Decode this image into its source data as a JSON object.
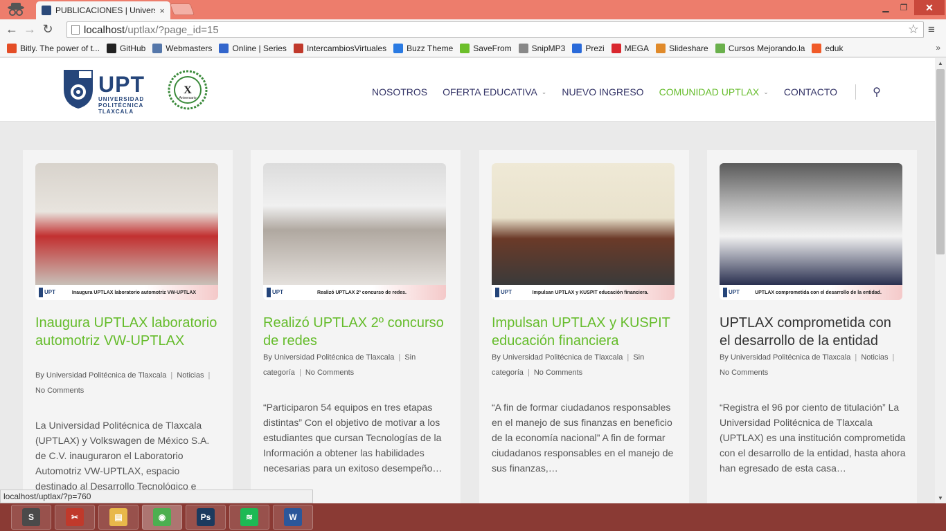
{
  "browser": {
    "tab_title": "PUBLICACIONES | Univers",
    "tab_close": "×",
    "url_host": "localhost",
    "url_path": "/uptlax/?page_id=15",
    "window_controls": {
      "minimize": "▁",
      "maximize": "❐",
      "close": "✕"
    },
    "nav_icons": {
      "back": "←",
      "forward": "→",
      "reload": "↻",
      "star": "☆",
      "menu": "≡"
    },
    "bookmarks": [
      {
        "label": "Bitly. The power of t...",
        "icon": "bitly-icon",
        "color": "#e44d26"
      },
      {
        "label": "GitHub",
        "icon": "github-icon",
        "color": "#222222"
      },
      {
        "label": "Webmasters",
        "icon": "webmasters-icon",
        "color": "#5577aa"
      },
      {
        "label": "Online | Series",
        "icon": "series-icon",
        "color": "#3366cc"
      },
      {
        "label": "IntercambiosVirtuales",
        "icon": "iv-icon",
        "color": "#c0392b"
      },
      {
        "label": "Buzz Theme",
        "icon": "buzz-icon",
        "color": "#2a7ae2"
      },
      {
        "label": "SaveFrom",
        "icon": "savefrom-icon",
        "color": "#6cbf2a"
      },
      {
        "label": "SnipMP3",
        "icon": "snipmp3-icon",
        "color": "#888888"
      },
      {
        "label": "Prezi",
        "icon": "prezi-icon",
        "color": "#2a6ad9"
      },
      {
        "label": "MEGA",
        "icon": "mega-icon",
        "color": "#d9272e"
      },
      {
        "label": "Slideshare",
        "icon": "slideshare-icon",
        "color": "#e08a2a"
      },
      {
        "label": "Cursos Mejorando.la",
        "icon": "mejorando-icon",
        "color": "#6ab04c"
      },
      {
        "label": "eduk",
        "icon": "eduk-icon",
        "color": "#f05a28"
      }
    ],
    "bookmarks_more": "»"
  },
  "site": {
    "logo_text": "UPT",
    "logo_sub": "UNIVERSIDAD POLITÉCNICA TLAXCALA",
    "anniv_numeral": "X",
    "anniv_label": "Aniversario",
    "nav": [
      {
        "label": "NOSOTROS",
        "caret": ""
      },
      {
        "label": "OFERTA EDUCATIVA",
        "caret": "⌄"
      },
      {
        "label": "NUEVO INGRESO",
        "caret": ""
      },
      {
        "label": "COMUNIDAD UPTLAX",
        "caret": "⌄"
      },
      {
        "label": "CONTACTO",
        "caret": ""
      }
    ],
    "search_icon": "⚲"
  },
  "posts": [
    {
      "title": "Inaugura UPTLAX laboratorio automotriz VW-UPTLAX",
      "caption": "Inaugura UPTLAX laboratorio automotriz VW-UPTLAX",
      "caption_logo": "UPT",
      "author": "By Universidad Politécnica de Tlaxcala",
      "category": "Noticias",
      "comments": "No Comments",
      "excerpt": "La Universidad Politécnica de Tlaxcala (UPTLAX) y Volkswagen de México S.A. de C.V. inauguraron el Laboratorio Automotriz VW-UPTLAX, espacio destinado al Desarrollo Tecnológico e"
    },
    {
      "title": "Realizó UPTLAX 2º concurso de redes",
      "caption": "Realizó UPTLAX 2º concurso de redes.",
      "caption_logo": "UPT",
      "author": "By Universidad Politécnica de Tlaxcala",
      "category": "Sin categoría",
      "comments": "No Comments",
      "excerpt": "“Participaron 54 equipos en tres etapas distintas” Con el objetivo de motivar a los estudiantes que cursan Tecnologías de la Información a obtener las habilidades necesarias para un exitoso desempeño…"
    },
    {
      "title": "Impulsan UPTLAX y KUSPIT educación financiera",
      "caption": "Impulsan UPTLAX y KUSPIT educación financiera.",
      "caption_logo": "UPT",
      "author": "By Universidad Politécnica de Tlaxcala",
      "category": "Sin categoría",
      "comments": "No Comments",
      "excerpt": "“A fin de formar ciudadanos responsables en el manejo de sus finanzas en beneficio de la economía nacional” A fin de formar ciudadanos responsables en el manejo de sus finanzas,…"
    },
    {
      "title": "UPTLAX comprometida con el desarrollo de la entidad",
      "caption": "UPTLAX comprometida con el desarrollo de la entidad.",
      "caption_logo": "UPT",
      "author": "By Universidad Politécnica de Tlaxcala",
      "category": "Noticias",
      "comments": "No Comments",
      "excerpt": "“Registra el 96 por ciento de titulación” La Universidad Politécnica de Tlaxcala (UPTLAX) es una institución comprometida con el desarrollo de la entidad, hasta ahora han egresado de esta casa…"
    }
  ],
  "meta_separator": "|",
  "status_url": "localhost/uptlax/?p=760",
  "taskbar": [
    {
      "icon": "sublime-text-icon",
      "glyph": "S",
      "color": "#4a4a4a"
    },
    {
      "icon": "snipping-tool-icon",
      "glyph": "✂",
      "color": "#c0392b"
    },
    {
      "icon": "file-explorer-icon",
      "glyph": "▤",
      "color": "#e8b84a"
    },
    {
      "icon": "chrome-icon",
      "glyph": "◉",
      "color": "#4caf50"
    },
    {
      "icon": "photoshop-icon",
      "glyph": "Ps",
      "color": "#1c3a5e"
    },
    {
      "icon": "spotify-icon",
      "glyph": "≋",
      "color": "#1db954"
    },
    {
      "icon": "word-icon",
      "glyph": "W",
      "color": "#2b579a"
    }
  ]
}
